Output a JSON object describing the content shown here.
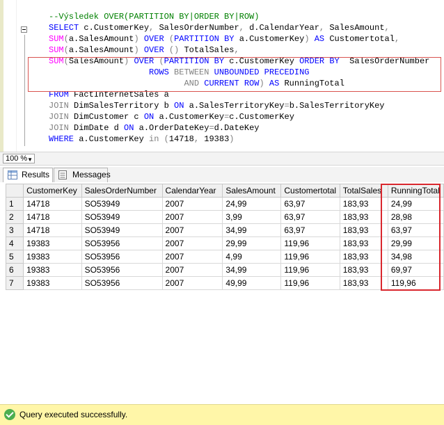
{
  "editor": {
    "lines": [
      [
        {
          "c": "cmt",
          "t": "--Výsledek OVER(PARTITION BY|ORDER BY|ROW)"
        }
      ],
      [
        {
          "c": "kw",
          "t": "SELECT "
        },
        {
          "c": "txt",
          "t": "c.CustomerKey"
        },
        {
          "c": "gray",
          "t": ", "
        },
        {
          "c": "txt",
          "t": "SalesOrderNumber"
        },
        {
          "c": "gray",
          "t": ", "
        },
        {
          "c": "txt",
          "t": "d.CalendarYear"
        },
        {
          "c": "gray",
          "t": ", "
        },
        {
          "c": "txt",
          "t": "SalesAmount"
        },
        {
          "c": "gray",
          "t": ","
        }
      ],
      [
        {
          "c": "fn",
          "t": "SUM"
        },
        {
          "c": "gray",
          "t": "("
        },
        {
          "c": "txt",
          "t": "a.SalesAmount"
        },
        {
          "c": "gray",
          "t": ") "
        },
        {
          "c": "kw",
          "t": "OVER "
        },
        {
          "c": "gray",
          "t": "("
        },
        {
          "c": "kw",
          "t": "PARTITION BY "
        },
        {
          "c": "txt",
          "t": "a.CustomerKey"
        },
        {
          "c": "gray",
          "t": ") "
        },
        {
          "c": "kw",
          "t": "AS "
        },
        {
          "c": "txt",
          "t": "Customertotal"
        },
        {
          "c": "gray",
          "t": ","
        }
      ],
      [
        {
          "c": "fn",
          "t": "SUM"
        },
        {
          "c": "gray",
          "t": "("
        },
        {
          "c": "txt",
          "t": "a.SalesAmount"
        },
        {
          "c": "gray",
          "t": ") "
        },
        {
          "c": "kw",
          "t": "OVER "
        },
        {
          "c": "gray",
          "t": "() "
        },
        {
          "c": "txt",
          "t": "TotalSales"
        },
        {
          "c": "gray",
          "t": ","
        }
      ],
      [
        {
          "c": "fn",
          "t": "SUM"
        },
        {
          "c": "gray",
          "t": "("
        },
        {
          "c": "txt",
          "t": "SalesAmount"
        },
        {
          "c": "gray",
          "t": ") "
        },
        {
          "c": "kw",
          "t": "OVER "
        },
        {
          "c": "gray",
          "t": "("
        },
        {
          "c": "kw",
          "t": "PARTITION BY "
        },
        {
          "c": "txt",
          "t": "c.CustomerKey "
        },
        {
          "c": "kw",
          "t": "ORDER BY  "
        },
        {
          "c": "txt",
          "t": "SalesOrderNumber"
        }
      ],
      [
        {
          "c": "txt",
          "t": "                    "
        },
        {
          "c": "kw",
          "t": "ROWS "
        },
        {
          "c": "gray",
          "t": "BETWEEN "
        },
        {
          "c": "kw",
          "t": "UNBOUNDED PRECEDING"
        }
      ],
      [
        {
          "c": "txt",
          "t": "                           "
        },
        {
          "c": "gray",
          "t": "AND "
        },
        {
          "c": "kw",
          "t": "CURRENT ROW"
        },
        {
          "c": "gray",
          "t": ") "
        },
        {
          "c": "kw",
          "t": "AS "
        },
        {
          "c": "txt",
          "t": "RunningTotal"
        }
      ],
      [
        {
          "c": "kw",
          "t": "FROM "
        },
        {
          "c": "txt",
          "t": "FactInternetSales a"
        }
      ],
      [
        {
          "c": "gray",
          "t": "JOIN "
        },
        {
          "c": "txt",
          "t": "DimSalesTerritory b "
        },
        {
          "c": "kw",
          "t": "ON "
        },
        {
          "c": "txt",
          "t": "a.SalesTerritoryKey"
        },
        {
          "c": "gray",
          "t": "="
        },
        {
          "c": "txt",
          "t": "b.SalesTerritoryKey"
        }
      ],
      [
        {
          "c": "gray",
          "t": "JOIN "
        },
        {
          "c": "txt",
          "t": "DimCustomer c "
        },
        {
          "c": "kw",
          "t": "ON "
        },
        {
          "c": "txt",
          "t": "a.CustomerKey"
        },
        {
          "c": "gray",
          "t": "="
        },
        {
          "c": "txt",
          "t": "c.CustomerKey"
        }
      ],
      [
        {
          "c": "gray",
          "t": "JOIN "
        },
        {
          "c": "txt",
          "t": "DimDate d "
        },
        {
          "c": "kw",
          "t": "ON "
        },
        {
          "c": "txt",
          "t": "a.OrderDateKey"
        },
        {
          "c": "gray",
          "t": "="
        },
        {
          "c": "txt",
          "t": "d.DateKey"
        }
      ],
      [
        {
          "c": "kw",
          "t": "WHERE "
        },
        {
          "c": "txt",
          "t": "a.CustomerKey "
        },
        {
          "c": "gray",
          "t": "in "
        },
        {
          "c": "gray",
          "t": "("
        },
        {
          "c": "num",
          "t": "14718"
        },
        {
          "c": "gray",
          "t": ", "
        },
        {
          "c": "num",
          "t": "19383"
        },
        {
          "c": "gray",
          "t": ")"
        }
      ]
    ]
  },
  "zoom": {
    "value": "100 %"
  },
  "tabs": [
    {
      "label": "Results",
      "active": true
    },
    {
      "label": "Messages",
      "active": false
    }
  ],
  "results": {
    "columns": [
      "CustomerKey",
      "SalesOrderNumber",
      "CalendarYear",
      "SalesAmount",
      "Customertotal",
      "TotalSales",
      "RunningTotal"
    ],
    "rows": [
      [
        "1",
        "14718",
        "SO53949",
        "2007",
        "24,99",
        "63,97",
        "183,93",
        "24,99"
      ],
      [
        "2",
        "14718",
        "SO53949",
        "2007",
        "3,99",
        "63,97",
        "183,93",
        "28,98"
      ],
      [
        "3",
        "14718",
        "SO53949",
        "2007",
        "34,99",
        "63,97",
        "183,93",
        "63,97"
      ],
      [
        "4",
        "19383",
        "SO53956",
        "2007",
        "29,99",
        "119,96",
        "183,93",
        "29,99"
      ],
      [
        "5",
        "19383",
        "SO53956",
        "2007",
        "4,99",
        "119,96",
        "183,93",
        "34,98"
      ],
      [
        "6",
        "19383",
        "SO53956",
        "2007",
        "34,99",
        "119,96",
        "183,93",
        "69,97"
      ],
      [
        "7",
        "19383",
        "SO53956",
        "2007",
        "49,99",
        "119,96",
        "183,93",
        "119,96"
      ]
    ]
  },
  "status": {
    "text": "Query executed successfully."
  }
}
